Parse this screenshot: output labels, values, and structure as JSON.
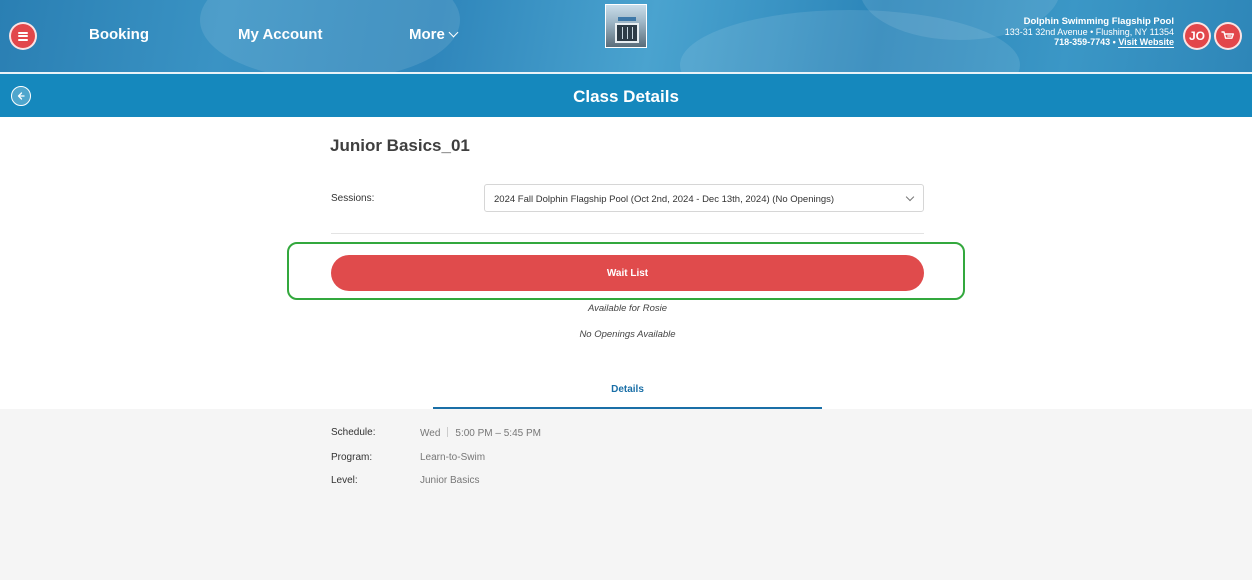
{
  "header": {
    "nav": {
      "booking": "Booking",
      "my_account": "My Account",
      "more": "More"
    },
    "venue": {
      "name": "Dolphin Swimming Flagship Pool",
      "address": "133-31 32nd Avenue • Flushing, NY 11354",
      "phone": "718-359-7743 • ",
      "website": "Visit Website"
    },
    "user_initials": "JO"
  },
  "titlebar": {
    "title": "Class Details"
  },
  "class": {
    "name": "Junior Basics_01",
    "sessions_label": "Sessions:",
    "sessions_value": "2024 Fall Dolphin Flagship Pool (Oct 2nd, 2024 - Dec 13th, 2024) (No Openings)",
    "wait_list_label": "Wait List",
    "available_for": "Available for Rosie",
    "openings_note": "No Openings Available"
  },
  "tabs": {
    "details": "Details"
  },
  "details": {
    "schedule_label": "Schedule:",
    "schedule_day": "Wed",
    "schedule_time": "5:00 PM – 5:45 PM",
    "program_label": "Program:",
    "program_value": "Learn-to-Swim",
    "level_label": "Level:",
    "level_value": "Junior Basics"
  },
  "colors": {
    "header_blue": "#2a7fb3",
    "title_bar": "#1588bd",
    "accent_red": "#e04b4c",
    "highlight_green": "#33a83d",
    "tab_blue": "#1a6fa7"
  },
  "icons": {
    "menu": "hamburger-menu-icon",
    "back": "arrow-left-icon",
    "cart": "cart-icon",
    "sessions_dropdown": "chevron-down-icon"
  }
}
